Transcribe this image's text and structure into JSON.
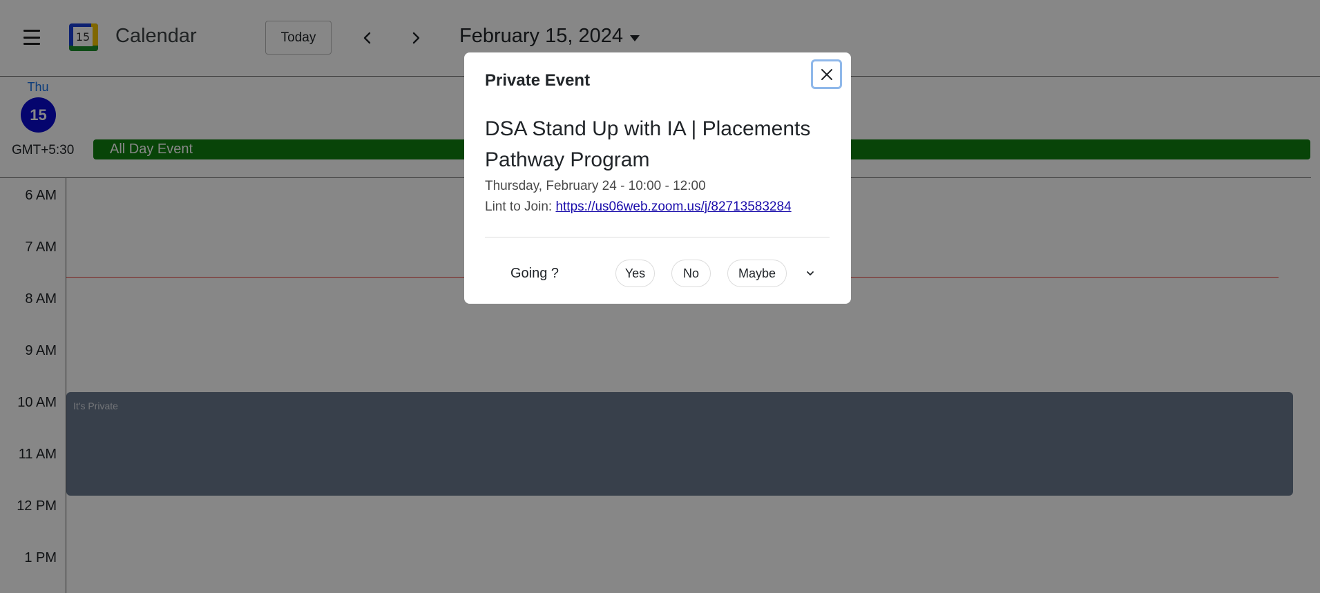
{
  "header": {
    "app_title": "Calendar",
    "logo_day": "15",
    "today_label": "Today",
    "date_title": "February 15, 2024"
  },
  "day_header": {
    "day_name": "Thu",
    "day_number": "15"
  },
  "timezone_label": "GMT+5:30",
  "all_day_event": {
    "title": "All Day Event",
    "color": "#108010"
  },
  "hours": [
    "6 AM",
    "7 AM",
    "8 AM",
    "9 AM",
    "10 AM",
    "11 AM",
    "12 PM",
    "1 PM"
  ],
  "timed_event": {
    "label": "It's Private",
    "color": "#6b7a8f"
  },
  "now_line_color": "#e53935",
  "modal": {
    "title": "Private Event",
    "event_name": "DSA Stand Up with IA | Placements Pathway Program",
    "time": "Thursday, February 24 - 10:00 - 12:00",
    "link_label": "Lint to Join:",
    "link_url": "https://us06web.zoom.us/j/82713583284",
    "going_label": "Going ?",
    "rsvp": {
      "yes": "Yes",
      "no": "No",
      "maybe": "Maybe"
    }
  },
  "icons": {
    "menu": "hamburger-menu-icon",
    "prev": "chevron-left-icon",
    "next": "chevron-right-icon",
    "date_dropdown": "caret-down-icon",
    "close": "close-icon",
    "more": "chevron-down-icon"
  }
}
